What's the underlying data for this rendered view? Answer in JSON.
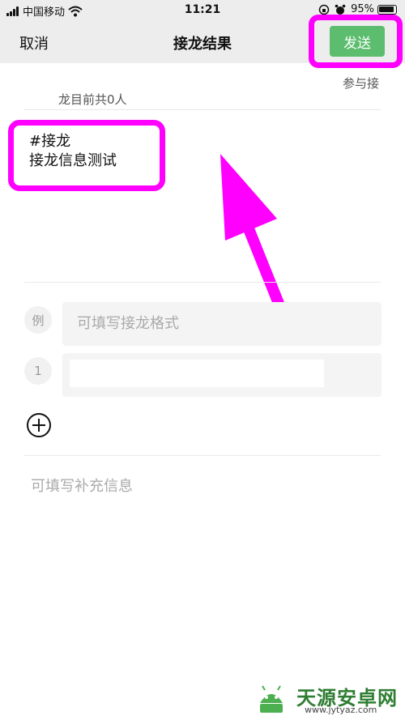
{
  "status_bar": {
    "carrier": "中国移动",
    "time": "11:21",
    "battery": "95%"
  },
  "nav": {
    "cancel_label": "取消",
    "title": "接龙结果",
    "send_label": "发送"
  },
  "participants": {
    "line1": "参与接",
    "line2": "龙目前共0人"
  },
  "content": {
    "lines": [
      "#接龙",
      "接龙信息测试"
    ]
  },
  "format_rows": [
    {
      "badge": "例",
      "placeholder": "可填写接龙格式"
    },
    {
      "badge": "1",
      "value": ""
    }
  ],
  "extra_info_placeholder": "可填写补充信息",
  "watermark": {
    "title": "天源安卓网",
    "url": "www.jytyaz.com"
  },
  "colors": {
    "highlight": "#ff00ff",
    "send_button": "#5cbd6e",
    "nav_background": "#ededed"
  }
}
